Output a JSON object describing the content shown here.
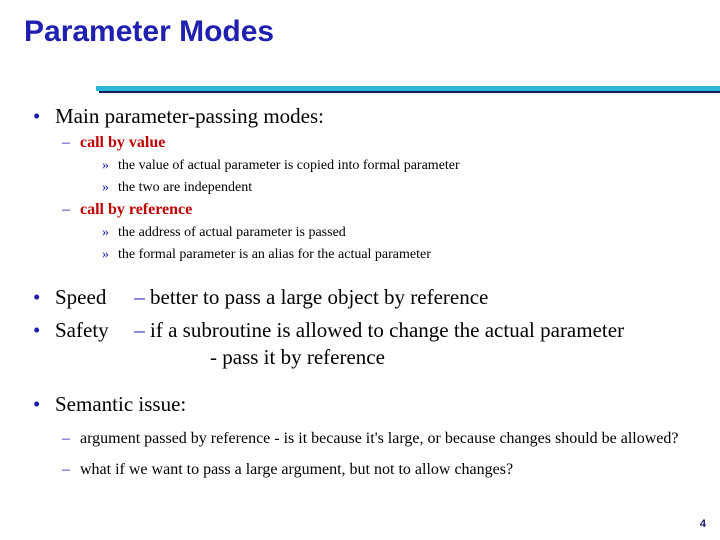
{
  "slide": {
    "title": "Parameter Modes",
    "page_number": "4",
    "colors": {
      "title_blue": "#2020B0",
      "rule_cyan": "#2BB8D8",
      "rule_shadow_navy": "#1A1A5E",
      "marker_navy": "#2020B0",
      "accent_red": "#C00000",
      "body_black": "#000000",
      "background": "#FFFFFF"
    }
  },
  "markers": {
    "bullet_dot": "•",
    "dash": "–",
    "guillemet": "»",
    "hyphen": "-"
  },
  "content": {
    "main_modes": {
      "heading": "Main parameter-passing modes:",
      "modes": [
        {
          "name": "call by value",
          "details": [
            "the value of actual parameter is copied into formal parameter",
            "the two are independent"
          ]
        },
        {
          "name": "call by reference",
          "details": [
            "the address of actual parameter is passed",
            "the formal parameter is an alias for the actual parameter"
          ]
        }
      ]
    },
    "criteria": [
      {
        "keyword": "Speed",
        "dash": "–",
        "text": "better to pass a large object by reference",
        "continuation": ""
      },
      {
        "keyword": "Safety",
        "dash": "–",
        "text": "if a subroutine is allowed to change the actual parameter",
        "continuation": "- pass it by reference"
      }
    ],
    "semantic_issue": {
      "heading": "Semantic issue:",
      "points": [
        "argument passed by reference - is it because it's large, or because changes should be allowed?",
        "what if we want to pass a large argument, but not to allow changes?"
      ]
    }
  }
}
